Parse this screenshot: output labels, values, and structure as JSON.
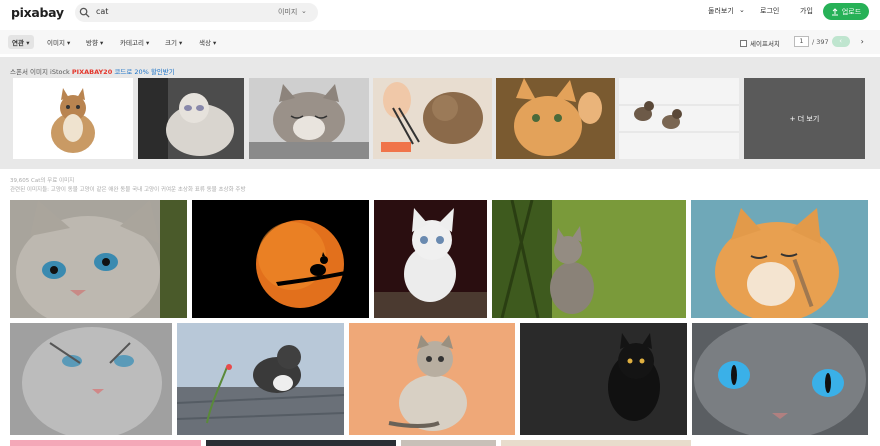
{
  "header": {
    "logo": "pixabay",
    "search_query": "cat",
    "search_type": "이미지",
    "explore_label": "둘러보기",
    "login_label": "로그인",
    "join_label": "가입",
    "upload_label": "업로드"
  },
  "filters": {
    "items": [
      "연관",
      "이미지",
      "방향",
      "카테고리",
      "크기",
      "색상"
    ],
    "safesearch_label": "세이프서치",
    "page_current": "1",
    "page_total": "/ 397"
  },
  "sponsored": {
    "prefix": "스폰서 이미지 iStock",
    "promo_code": "PIXABAY20",
    "promo_text": "코드로 20% 할인받기",
    "more_label": "+ 더 보기"
  },
  "results": {
    "count_text": "39,605 Cat의 무료 이미지",
    "related_text": "관련된 이미지들: 고양이 동물 고양이 같은 애완 동물 국내 고양이 귀여운 초상화 표류 동물 초상화 주방"
  },
  "colors": {
    "brand": "#27b157",
    "promo": "#e4362b",
    "link": "#1e74c8"
  }
}
